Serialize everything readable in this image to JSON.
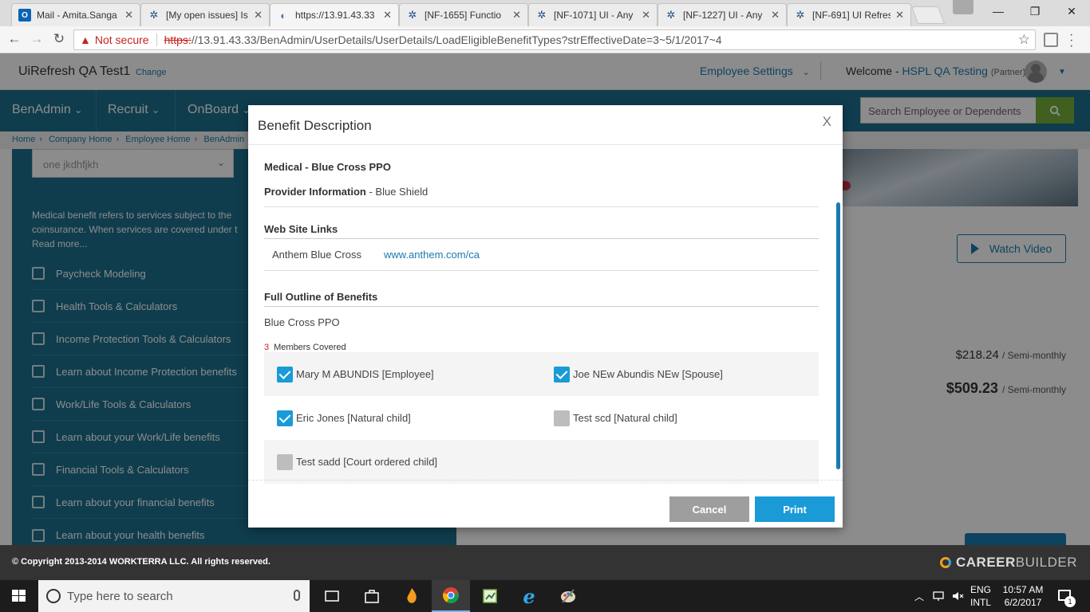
{
  "browser": {
    "tabs": [
      {
        "title": "Mail - Amita.Sanga",
        "icon": "outlook-icon"
      },
      {
        "title": "[My open issues] Is",
        "icon": "jira-icon"
      },
      {
        "title": "https://13.91.43.33",
        "icon": "page-icon"
      },
      {
        "title": "[NF-1655] Functio",
        "icon": "jira-icon"
      },
      {
        "title": "[NF-1071] UI - Any",
        "icon": "jira-icon"
      },
      {
        "title": "[NF-1227] UI - Any",
        "icon": "jira-icon"
      },
      {
        "title": "[NF-691] UI Refresh",
        "icon": "jira-icon"
      }
    ],
    "not_secure": "Not secure",
    "url_scheme": "https:",
    "url_rest": "//13.91.43.33/BenAdmin/UserDetails/UserDetails/LoadEligibleBenefitTypes?strEffectiveDate=3~5/1/2017~4"
  },
  "header": {
    "company": "UiRefresh QA Test1",
    "change": "Change",
    "employee_settings": "Employee Settings",
    "welcome": "Welcome -",
    "user": "HSPL QA Testing",
    "role": "(Partner)"
  },
  "nav": {
    "items": [
      "BenAdmin",
      "Recruit",
      "OnBoard"
    ],
    "search_placeholder": "Search Employee or Dependents"
  },
  "breadcrumb": [
    "Home",
    "Company Home",
    "Employee Home",
    "BenAdmin"
  ],
  "left": {
    "dropdown": "one jkdhfjkh",
    "description": "Medical benefit refers to services subject to the coinsurance. When services are covered under t",
    "read_more": "Read more...",
    "tools": [
      "Paycheck Modeling",
      "Health Tools & Calculators",
      "Income Protection Tools & Calculators",
      "Learn about Income Protection benefits",
      "Work/Life Tools & Calculators",
      "Learn about your Work/Life benefits",
      "Financial Tools & Calculators",
      "Learn about your financial benefits",
      "Learn about your health benefits"
    ]
  },
  "right": {
    "watch_video": "Watch Video",
    "price1": "$218.24",
    "price1_unit": "/ Semi-monthly",
    "price2": "$509.23",
    "price2_unit": "/ Semi-monthly"
  },
  "footer": {
    "copyright": "© Copyright 2013-2014 WORKTERRA LLC. All rights reserved.",
    "brand_bold": "CAREER",
    "brand_light": "BUILDER"
  },
  "modal": {
    "title": "Benefit Description",
    "close": "X",
    "plan": "Medical - Blue Cross PPO",
    "provider_label": "Provider Information",
    "provider_value": "- Blue Shield",
    "links_title": "Web Site Links",
    "link_name": "Anthem Blue Cross",
    "link_url": "www.anthem.com/ca",
    "outline_title": "Full Outline of Benefits",
    "outline_value": "Blue Cross PPO",
    "members_count": "3",
    "members_label": "Members Covered",
    "members": [
      {
        "name": "Mary M ABUNDIS [Employee]",
        "checked": true
      },
      {
        "name": "Joe NEw Abundis NEw [Spouse]",
        "checked": true
      },
      {
        "name": "Eric Jones [Natural child]",
        "checked": true
      },
      {
        "name": "Test scd [Natural child]",
        "checked": false
      },
      {
        "name": "Test sadd [Court ordered child]",
        "checked": false
      }
    ],
    "cancel": "Cancel",
    "print": "Print"
  },
  "taskbar": {
    "search_placeholder": "Type here to search",
    "lang1": "ENG",
    "lang2": "INTL",
    "time": "10:57 AM",
    "date": "6/2/2017",
    "notif_count": "1"
  }
}
